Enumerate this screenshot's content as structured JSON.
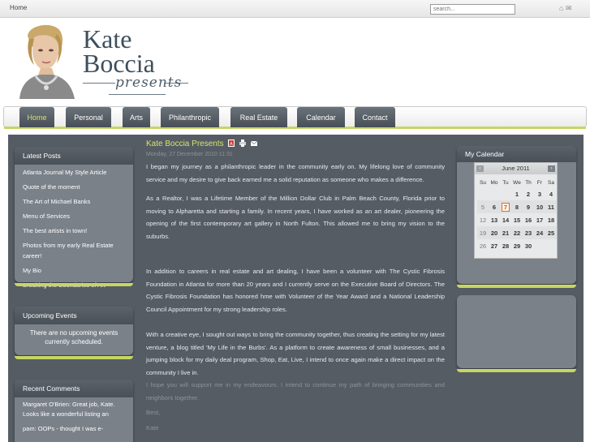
{
  "topbar": {
    "home": "Home",
    "search_placeholder": "search..."
  },
  "logo": {
    "line1": "Kate",
    "line2": "Boccia",
    "line3": "presents"
  },
  "nav": [
    {
      "label": "Home",
      "active": true
    },
    {
      "label": "Personal"
    },
    {
      "label": "Arts"
    },
    {
      "label": "Philanthropic"
    },
    {
      "label": "Real Estate"
    },
    {
      "label": "Calendar"
    },
    {
      "label": "Contact"
    }
  ],
  "latest_posts": {
    "title": "Latest Posts",
    "items": [
      "Atlanta Journal My Style Article",
      "Quote of the moment",
      "The Art of Michael Banks",
      "Menu of Services",
      "The best artists in town!",
      "Photos from my early Real Estate career!",
      "My Bio",
      "Breaking the Boundaries of Art"
    ]
  },
  "upcoming_events": {
    "title": "Upcoming Events",
    "text": "There are no upcoming events currently scheduled."
  },
  "recent_comments": {
    "title": "Recent Comments",
    "items": [
      "Margaret O'Brien: Great job, Kate. Looks like a wonderful listing an",
      "pam: OOPs - thought I was e-"
    ]
  },
  "post": {
    "title": "Kate Boccia Presents",
    "date": "Monday, 27 December 2010 11:31",
    "paragraphs": [
      "I began my journey as a philanthropic leader in the community early on. My lifelong love of community service and my desire to give back earned me a solid reputation as someone who makes a difference.",
      "As a Realtor, I was a Lifetime Member of the Million Dollar Club in Palm Beach County, Florida prior to moving to Alpharetta and starting a family. In recent years, I have worked as an art dealer, pioneering the opening of the first contemporary art gallery in North Fulton. This allowed me to bring my vision to the suburbs.",
      "In addition to careers in real estate and art dealing, I have been a volunteer with The Cystic Fibrosis Foundation in Atlanta for more than 20 years and I currently serve on the Executive Board of Directors. The Cystic Fibrosis Foundation has honored hme with Volunteer of the Year Award and a National Leadership Council Appointment for my strong leadership roles.",
      "With a creative eye, I sought out ways to bring the community together, thus creating the setting for my latest venture, a blog titled 'My Life in the Burbs'. As a platform to create awareness of small businesses, and a jumping block for my daily deal program, Shop, Eat, Live, I intend to once again make a direct impact on the community I live in.",
      "I hope you will support me in my endeavours. I intend to continue my path of bringing communities and neighbors together.",
      "Best,",
      "Kate"
    ]
  },
  "calendar": {
    "title": "My Calendar",
    "month": "June 2011",
    "days": [
      "Su",
      "Mo",
      "Tu",
      "We",
      "Th",
      "Fr",
      "Sa"
    ],
    "weeks": [
      [
        "",
        "",
        "",
        "1",
        "2",
        "3",
        "4"
      ],
      [
        "5",
        "6",
        "7",
        "8",
        "9",
        "10",
        "11"
      ],
      [
        "12",
        "13",
        "14",
        "15",
        "16",
        "17",
        "18"
      ],
      [
        "19",
        "20",
        "21",
        "22",
        "23",
        "24",
        "25"
      ],
      [
        "26",
        "27",
        "28",
        "29",
        "30",
        "",
        ""
      ]
    ],
    "today": "7"
  }
}
